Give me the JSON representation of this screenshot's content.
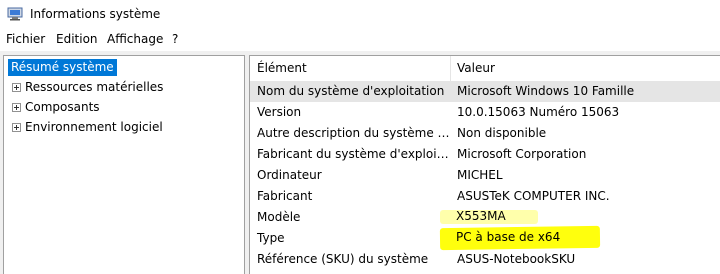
{
  "window": {
    "title": "Informations système",
    "icon": "system-info-icon"
  },
  "menu": {
    "items": [
      "Fichier",
      "Edition",
      "Affichage",
      "?"
    ]
  },
  "tree": {
    "root": "Résumé système",
    "items": [
      {
        "label": "Ressources matérielles"
      },
      {
        "label": "Composants"
      },
      {
        "label": "Environnement logiciel"
      }
    ]
  },
  "table": {
    "headers": [
      "Élément",
      "Valeur"
    ],
    "rows": [
      {
        "element": "Nom du système d'exploitation",
        "value": "Microsoft Windows 10 Famille"
      },
      {
        "element": "Version",
        "value": "10.0.15063 Numéro 15063"
      },
      {
        "element": "Autre description du système d...",
        "value": "Non disponible"
      },
      {
        "element": "Fabricant du système d'exploit...",
        "value": "Microsoft Corporation"
      },
      {
        "element": "Ordinateur",
        "value": "MICHEL"
      },
      {
        "element": "Fabricant",
        "value": "ASUSTeK COMPUTER INC."
      },
      {
        "element": "Modèle",
        "value": "X553MA"
      },
      {
        "element": "Type",
        "value": "PC à base de x64"
      },
      {
        "element": "Référence (SKU) du système",
        "value": "ASUS-NotebookSKU"
      }
    ]
  },
  "colors": {
    "selection": "#0078d7",
    "highlighter": "#ffff00"
  }
}
